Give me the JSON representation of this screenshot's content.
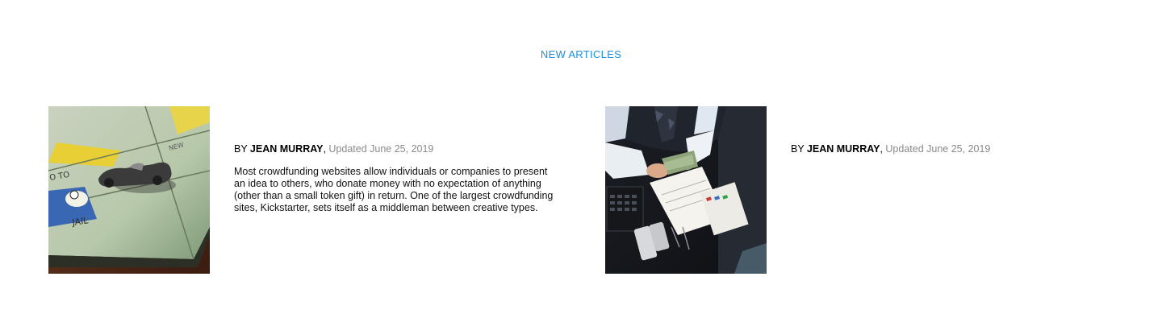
{
  "section": {
    "title": "NEW ARTICLES",
    "accent_color": "#1a8fe0"
  },
  "articles": [
    {
      "image": "monopoly-board-car-token",
      "by": "BY ",
      "author": "JEAN MURRAY",
      "separator": ", ",
      "updated": "Updated June 25, 2019",
      "excerpt": "Most crowdfunding websites allow individuals or companies to present an idea to others, who donate money with no expectation of anything (other than a small token gift) in return. One of the largest crowdfunding sites, Kickstarter, sets itself as a middleman between creative types."
    },
    {
      "image": "businessman-counting-money-desk",
      "by": "BY ",
      "author": "JEAN MURRAY",
      "separator": ", ",
      "updated": "Updated June 25, 2019",
      "excerpt": ""
    }
  ]
}
